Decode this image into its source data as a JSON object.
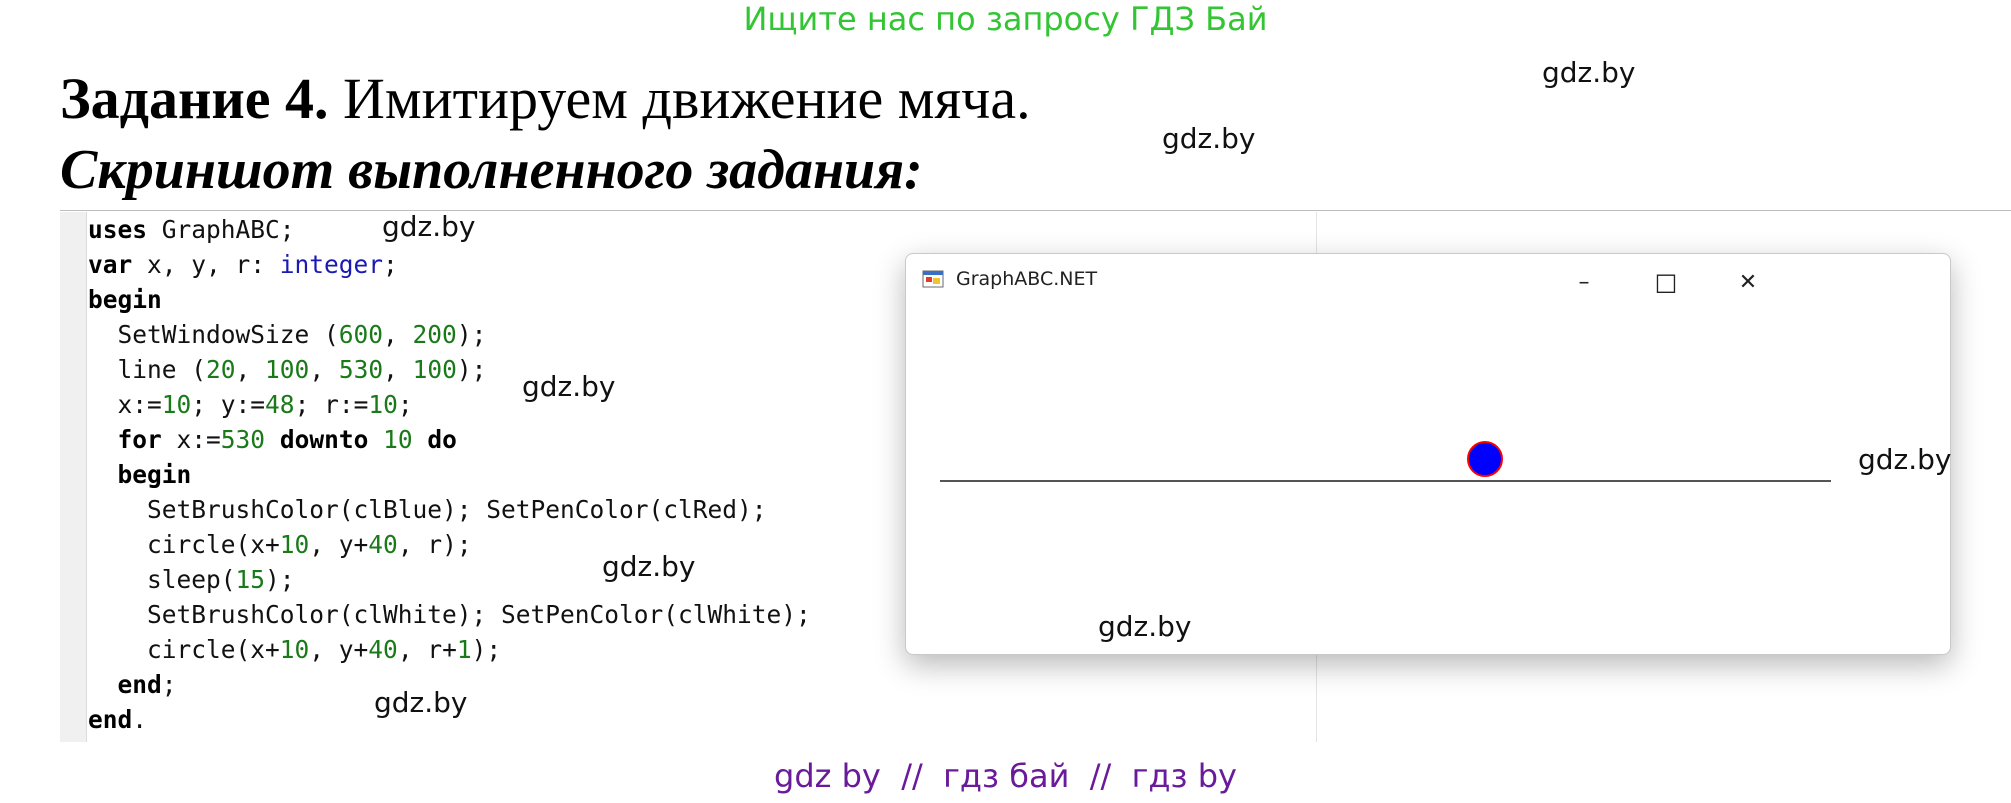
{
  "banner": "Ищите нас по запросу ГДЗ Бай",
  "heading": {
    "task_label": "Задание 4.",
    "task_text": " Имитируем движение мяча."
  },
  "subheading": "Скриншот выполненного задания:",
  "watermarks": [
    "gdz.by",
    "gdz.by",
    "gdz.by",
    "gdz.by",
    "gdz.by",
    "gdz.by",
    "gdz.by",
    "gdz.by"
  ],
  "code": {
    "l1": {
      "kw": "uses",
      "rest": " GraphABC;"
    },
    "l2": {
      "kw": "var",
      "rest": " x, y, r: ",
      "type": "integer",
      "end": ";"
    },
    "l3": {
      "kw": "begin"
    },
    "l4": {
      "a": "  SetWindowSize (",
      "n1": "600",
      "b": ", ",
      "n2": "200",
      "c": ");"
    },
    "l5": {
      "a": "  line (",
      "n1": "20",
      "b": ", ",
      "n2": "100",
      "c": ", ",
      "n3": "530",
      "d": ", ",
      "n4": "100",
      "e": ");"
    },
    "l6": {
      "a": "  x:=",
      "n1": "10",
      "b": "; y:=",
      "n2": "48",
      "c": "; r:=",
      "n3": "10",
      "d": ";"
    },
    "l7": {
      "a": "  ",
      "kw1": "for",
      "b": " x:=",
      "n1": "530",
      "c": " ",
      "kw2": "downto",
      "d": " ",
      "n2": "10",
      "e": " ",
      "kw3": "do"
    },
    "l8": {
      "a": "  ",
      "kw": "begin"
    },
    "l9": "    SetBrushColor(clBlue); SetPenColor(clRed);",
    "l10": {
      "a": "    circle(x+",
      "n1": "10",
      "b": ", y+",
      "n2": "40",
      "c": ", r);"
    },
    "l11": {
      "a": "    sleep(",
      "n1": "15",
      "b": ");"
    },
    "l12": "    SetBrushColor(clWhite); SetPenColor(clWhite);",
    "l13": {
      "a": "    circle(x+",
      "n1": "10",
      "b": ", y+",
      "n2": "40",
      "c": ", r+",
      "n3": "1",
      "d": ");"
    },
    "l14": {
      "a": "  ",
      "kw": "end",
      "b": ";"
    },
    "l15": {
      "kw": "end",
      "b": "."
    }
  },
  "window": {
    "title": "GraphABC.NET",
    "app_icon": "graphabc-app-icon",
    "controls": {
      "minimize": "–",
      "maximize": "□",
      "close": "✕"
    },
    "ball_fill": "#0000ff",
    "ball_stroke": "#ff0000",
    "line_color": "#555555"
  },
  "footer": "gdz by  //  гдз бай  //  гдз by"
}
